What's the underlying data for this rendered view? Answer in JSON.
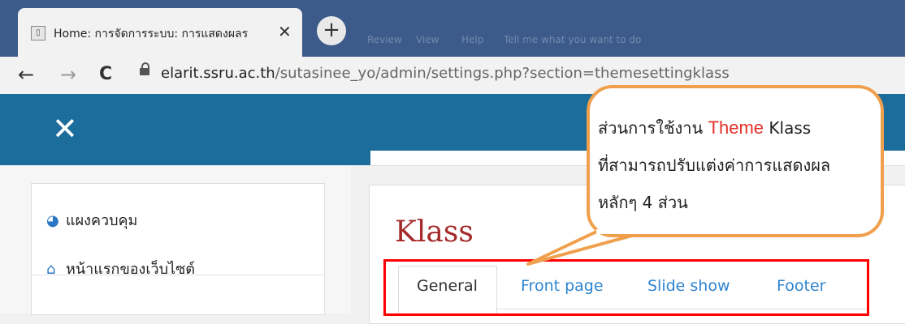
{
  "browser": {
    "tab_title": "Home: การจัดการระบบ: การแสดงผลร",
    "tab_close": "✕",
    "new_tab": "+",
    "background_menu": [
      "Review",
      "View",
      "Help",
      "Tell me what you want to do"
    ],
    "nav": {
      "back": "←",
      "forward": "→",
      "reload": "C"
    },
    "url_host": "elarit.ssru.ac.th",
    "url_path": "/sutasinee_yo/admin/settings.php?section=themesettingklass"
  },
  "navbar": {
    "close": "✕"
  },
  "sidebar": {
    "items": [
      {
        "icon": "dashboard-icon",
        "label": "แผงควบคุม"
      },
      {
        "icon": "home-icon",
        "label": "หน้าแรกของเว็บไซต์"
      }
    ]
  },
  "main": {
    "heading": "Klass",
    "tabs": [
      {
        "label": "General",
        "active": true
      },
      {
        "label": "Front page",
        "active": false
      },
      {
        "label": "Slide show",
        "active": false
      },
      {
        "label": "Footer",
        "active": false
      }
    ]
  },
  "callout": {
    "line1_prefix": "ส่วนการใช้งาน",
    "line1_accent": "Theme",
    "line1_suffix": "Klass",
    "line2": "ที่สามารถปรับแต่งค่าการแสดงผล",
    "line3": "หลักๆ 4 ส่วน"
  },
  "colors": {
    "navbar": "#1c6d9b",
    "heading": "#a52a2a",
    "highlight_box": "#ff0000",
    "callout_border": "#f0a04d",
    "accent": "#e4322b"
  }
}
